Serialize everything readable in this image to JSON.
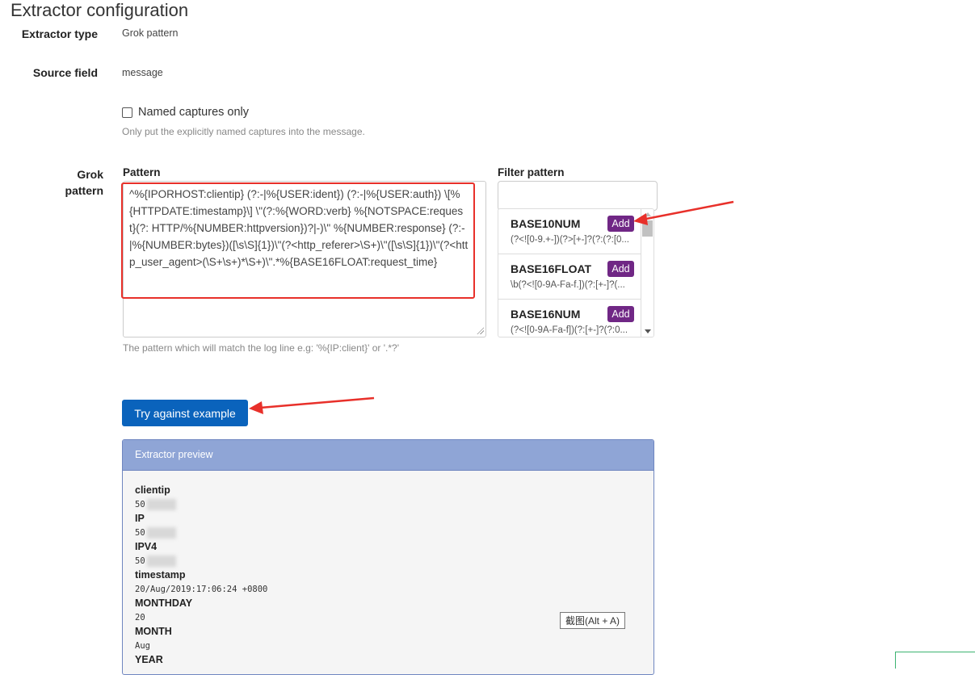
{
  "page_title": "Extractor configuration",
  "extractor_type": {
    "label": "Extractor type",
    "value": "Grok pattern"
  },
  "source_field": {
    "label": "Source field",
    "value": "message"
  },
  "named_captures": {
    "label": "Named captures only",
    "checked": false,
    "help": "Only put the explicitly named captures into the message."
  },
  "grok": {
    "label": "Grok pattern",
    "pattern_label": "Pattern",
    "pattern_value": "^%{IPORHOST:clientip} (?:-|%{USER:ident}) (?:-|%{USER:auth}) \\[%{HTTPDATE:timestamp}\\] \\\"(?:%{WORD:verb} %{NOTSPACE:request}(?: HTTP/%{NUMBER:httpversion})?|-)\\\" %{NUMBER:response} (?:-|%{NUMBER:bytes})([\\s\\S]{1})\\\"(?<http_referer>\\S+)\\\"([\\s\\S]{1})\\\"(?<http_user_agent>(\\S+\\s+)*\\S+)\\\".*%{BASE16FLOAT:request_time}",
    "pattern_help": "The pattern which will match the log line e.g: '%{IP:client}' or '.*?'",
    "filter_label": "Filter pattern",
    "filter_value": "",
    "filter_items": [
      {
        "name": "BASE10NUM",
        "regex": "(?<![0-9.+-])(?>[+-]?(?:(?:[0...",
        "add_label": "Add"
      },
      {
        "name": "BASE16FLOAT",
        "regex": "\\b(?<![0-9A-Fa-f.])(?:[+-]?(...",
        "add_label": "Add"
      },
      {
        "name": "BASE16NUM",
        "regex": "(?<![0-9A-Fa-f])(?:[+-]?(?:0...",
        "add_label": "Add"
      }
    ]
  },
  "try_button": {
    "label": "Try against example"
  },
  "preview": {
    "title": "Extractor preview",
    "fields": [
      {
        "key": "clientip",
        "value": "50",
        "redacted": true
      },
      {
        "key": "IP",
        "value": "50",
        "redacted": true
      },
      {
        "key": "IPV4",
        "value": "50",
        "redacted": true
      },
      {
        "key": "timestamp",
        "value": "20/Aug/2019:17:06:24 +0800",
        "redacted": false
      },
      {
        "key": "MONTHDAY",
        "value": "20",
        "redacted": false
      },
      {
        "key": "MONTH",
        "value": "Aug",
        "redacted": false
      },
      {
        "key": "YEAR",
        "value": "",
        "redacted": false
      }
    ]
  },
  "tooltip": {
    "text": "截图(Alt + A)"
  },
  "colors": {
    "primary_button": "#0a63bc",
    "add_button": "#702785",
    "preview_header": "#8fa5d6",
    "annotation_red": "#e8302a"
  }
}
